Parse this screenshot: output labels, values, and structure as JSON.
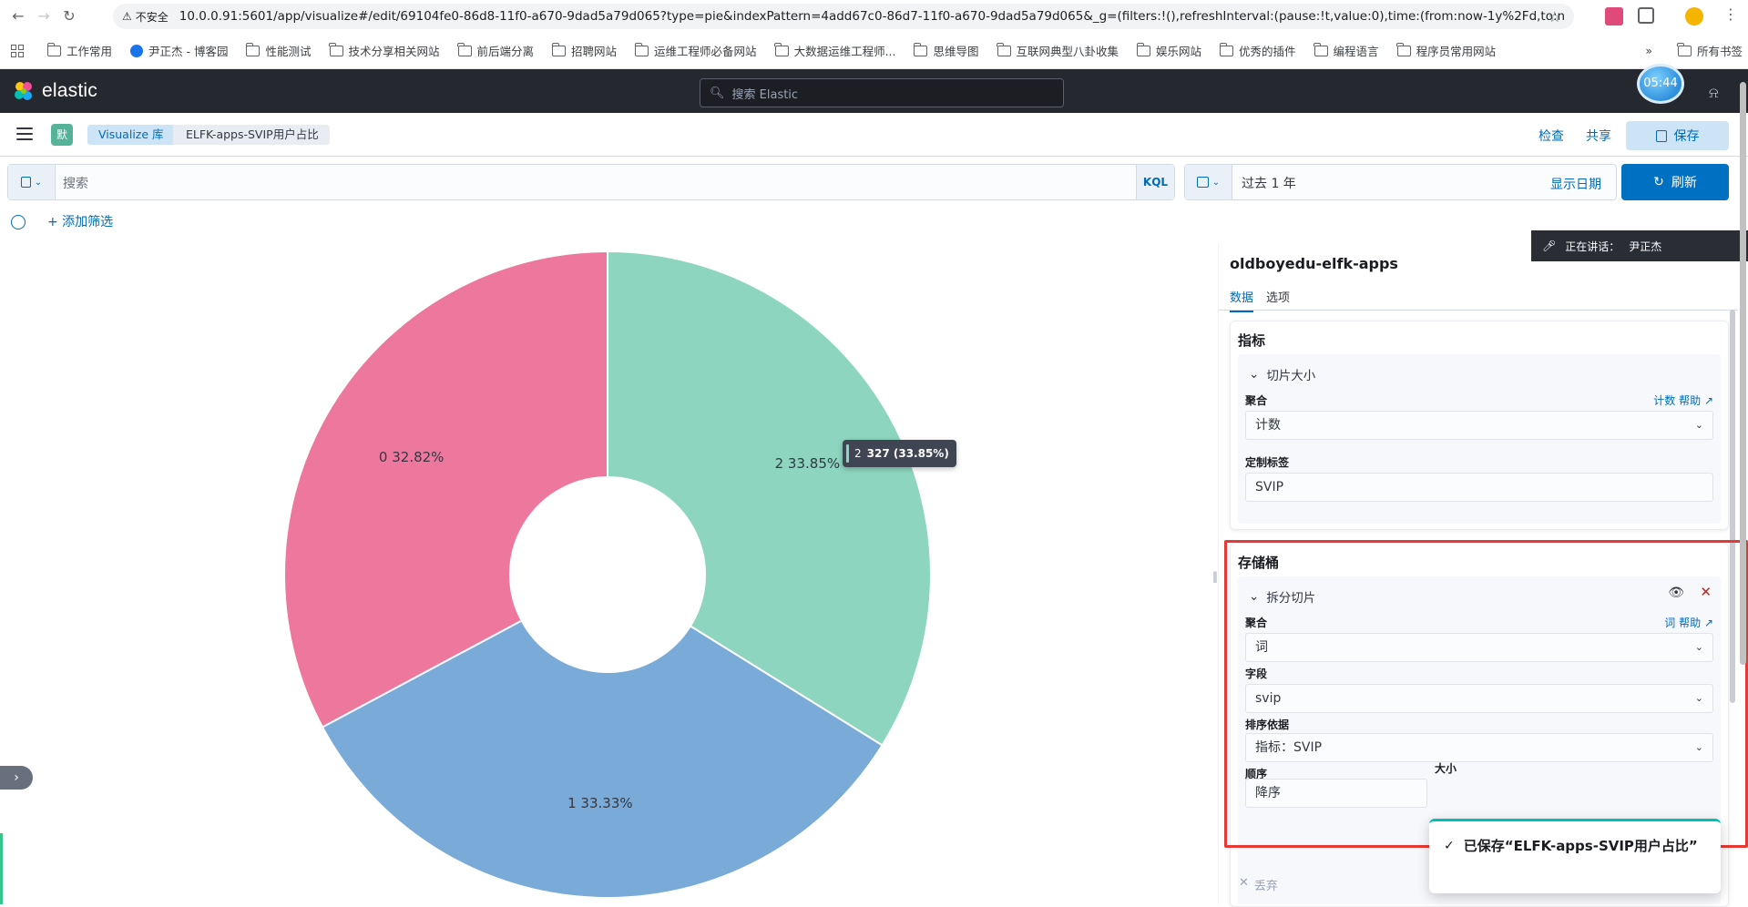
{
  "browser": {
    "insecure_label": "不安全",
    "url": "10.0.0.91:5601/app/visualize#/edit/69104fe0-86d8-11f0-a670-9dad5a79d065?type=pie&indexPattern=4add67c0-86d7-11f0-a670-9dad5a79d065&_g=(filters:!(),refreshInterval:(pause:!t,value:0),time:(from:now-1y%2Fd,to:n..."
  },
  "bookmarks": [
    "工作常用",
    "尹正杰 - 博客园",
    "性能测试",
    "技术分享相关网站",
    "前后端分离",
    "招聘网站",
    "运维工程师必备网站",
    "大数据运维工程师...",
    "思维导图",
    "互联网典型八卦收集",
    "娱乐网站",
    "优秀的插件",
    "编程语言",
    "程序员常用网站"
  ],
  "bookmarks_more": "»",
  "bookmarks_all": "所有书签",
  "clock": "05:44",
  "kibana": {
    "logo_text": "elastic",
    "search_placeholder": "搜索 Elastic",
    "space_avatar": "默",
    "breadcrumbs": [
      "Visualize 库",
      "ELFK-apps-SVIP用户占比"
    ],
    "inspect": "检查",
    "share": "共享",
    "save": "保存"
  },
  "query": {
    "placeholder": "搜索",
    "language": "KQL",
    "date_range": "过去 1 年",
    "show_dates": "显示日期",
    "refresh": "刷新",
    "add_filter": "+ 添加筛选"
  },
  "chart_data": {
    "type": "pie",
    "donut": true,
    "categories": [
      "2",
      "1",
      "0"
    ],
    "values": [
      33.85,
      33.33,
      32.82
    ],
    "labels": [
      "2 33.85%",
      "1 33.33%",
      "0 32.82%"
    ],
    "colors": [
      "#8dd5bf",
      "#79aad8",
      "#ee789d"
    ],
    "tooltip": {
      "category": "2",
      "text": "327 (33.85%)"
    }
  },
  "sidebar": {
    "index_pattern": "oldboyedu-elfk-apps",
    "tabs": [
      "数据",
      "选项"
    ],
    "metrics": {
      "title": "指标",
      "item_title": "切片大小",
      "agg_label": "聚合",
      "agg_help": "计数 帮助",
      "agg_value": "计数",
      "custom_label": "定制标签",
      "custom_value": "SVIP"
    },
    "buckets": {
      "title": "存储桶",
      "item_title": "拆分切片",
      "agg_label": "聚合",
      "agg_help": "词 帮助",
      "agg_value": "词",
      "field_label": "字段",
      "field_value": "svip",
      "order_by_label": "排序依据",
      "order_by_value": "指标：SVIP",
      "order_label": "顺序",
      "size_label": "大小",
      "order_value": "降序"
    },
    "discard": "丢弃"
  },
  "voice": {
    "label": "正在讲话：",
    "speaker": "尹正杰"
  },
  "toast": {
    "text": "已保存“ELFK-apps-SVIP用户占比”"
  }
}
